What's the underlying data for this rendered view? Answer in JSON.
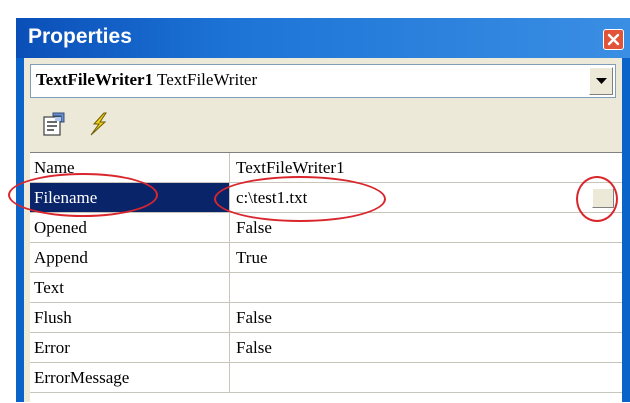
{
  "window": {
    "title": "Properties",
    "close_icon": "close-icon"
  },
  "component_select": {
    "name": "TextFileWriter1",
    "type": "TextFileWriter"
  },
  "toolbar": {
    "properties_icon": "properties-page-icon",
    "events_icon": "lightning-events-icon"
  },
  "properties": [
    {
      "name": "Name",
      "value": "TextFileWriter1"
    },
    {
      "name": "Filename",
      "value": "c:\\test1.txt"
    },
    {
      "name": "Opened",
      "value": "False"
    },
    {
      "name": "Append",
      "value": "True"
    },
    {
      "name": "Text",
      "value": ""
    },
    {
      "name": "Flush",
      "value": "False"
    },
    {
      "name": "Error",
      "value": "False"
    },
    {
      "name": "ErrorMessage",
      "value": ""
    }
  ],
  "selected_property": "Filename",
  "colors": {
    "titlebar": "#1d74d6",
    "selection": "#0a246a",
    "annotation": "#d9262c"
  }
}
